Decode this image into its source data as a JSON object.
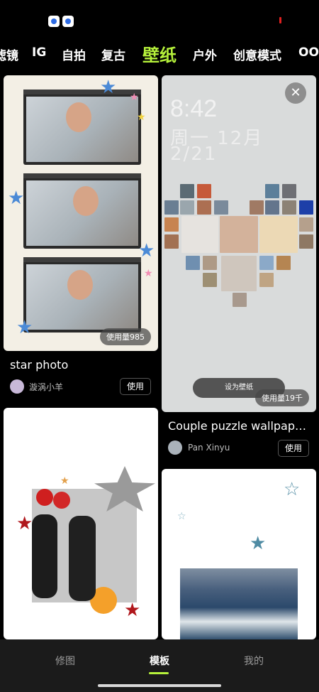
{
  "status_bar": {
    "icons": [
      "app-icon",
      "app-icon"
    ],
    "indicator_color": "#e02020"
  },
  "categories": {
    "items": [
      "滤镜",
      "IG",
      "自拍",
      "复古",
      "壁纸",
      "户外",
      "创意模式",
      "OO"
    ],
    "active": "壁纸",
    "active_color": "#b6f23b"
  },
  "cards": [
    {
      "title": "star photo",
      "author": "漩涡小羊",
      "usage": "使用量985",
      "action": "使用"
    },
    {
      "title": "Couple puzzle wallpape...",
      "author": "Pan Xinyu",
      "usage": "使用量19千",
      "action": "使用",
      "preview": {
        "time": "8:42",
        "date": "周一 12月",
        "year": "2/21",
        "button": "设为壁纸"
      }
    },
    {
      "title": "",
      "author": ""
    },
    {
      "title": "",
      "author": ""
    }
  ],
  "bottom_nav": {
    "items": [
      "修图",
      "模板",
      "我的"
    ],
    "active": "模板"
  }
}
